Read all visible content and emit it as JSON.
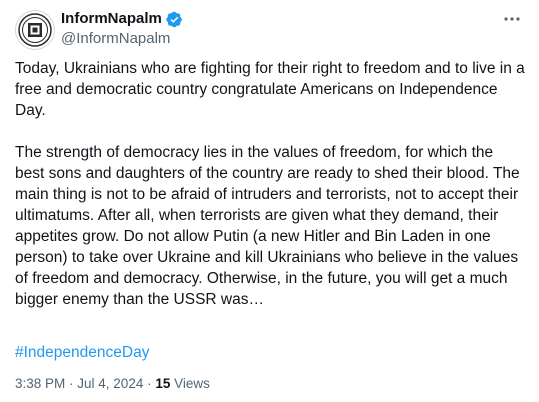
{
  "author": {
    "name": "InformNapalm",
    "handle": "@InformNapalm"
  },
  "post": {
    "paragraph1": "Today, Ukrainians who are fighting for their right to freedom and to live in a free and democratic country congratulate Americans on Independence Day.",
    "paragraph2": "The strength of democracy lies in the values of freedom, for which the best sons and daughters of the country are ready to shed their blood. The main thing is not to be afraid of intruders and terrorists, not to accept their ultimatums. After all, when terrorists are given what they demand, their appetites grow. Do not allow Putin (a new Hitler and Bin Laden in one person) to take over Ukraine and kill Ukrainians who believe in the values of freedom and democracy. Otherwise, in the future, you will get a much bigger enemy than the USSR was…",
    "hashtag": "#IndependenceDay"
  },
  "meta": {
    "time": "3:38 PM",
    "separator": " · ",
    "date": "Jul 4, 2024",
    "separator2": " · ",
    "views_count": "15",
    "views_label": " Views"
  },
  "icons": {
    "avatar": "informnapalm-logo",
    "verified": "verified-badge-icon",
    "more": "more-options-icon"
  },
  "colors": {
    "text": "#0f1419",
    "secondary": "#536471",
    "link": "#1d9bf0",
    "verified": "#1d9bf0"
  }
}
